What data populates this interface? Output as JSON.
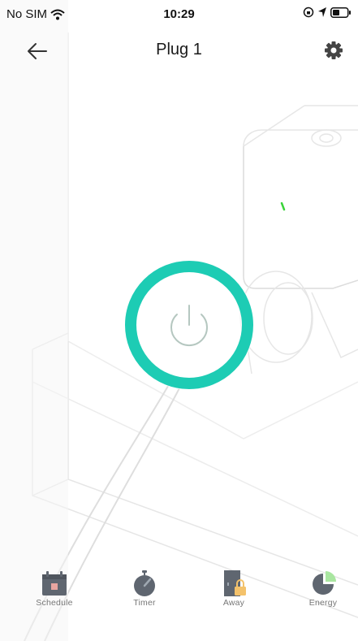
{
  "status_bar": {
    "carrier": "No SIM",
    "time": "10:29"
  },
  "header": {
    "title": "Plug 1"
  },
  "power": {
    "ring_color": "#1DCCB4",
    "icon_color": "#b5c7c0"
  },
  "toolbar": {
    "items": [
      {
        "label": "Schedule",
        "icon": "calendar-icon"
      },
      {
        "label": "Timer",
        "icon": "stopwatch-icon"
      },
      {
        "label": "Away",
        "icon": "door-lock-icon"
      },
      {
        "label": "Energy",
        "icon": "pie-chart-icon"
      }
    ]
  },
  "colors": {
    "accent": "#1DCCB4",
    "led": "#3ad33a",
    "icon_gray": "#5f6670",
    "schedule_mark": "#e8a5a0",
    "away_lock": "#f4c26b",
    "energy_slice": "#a9e6a0"
  }
}
